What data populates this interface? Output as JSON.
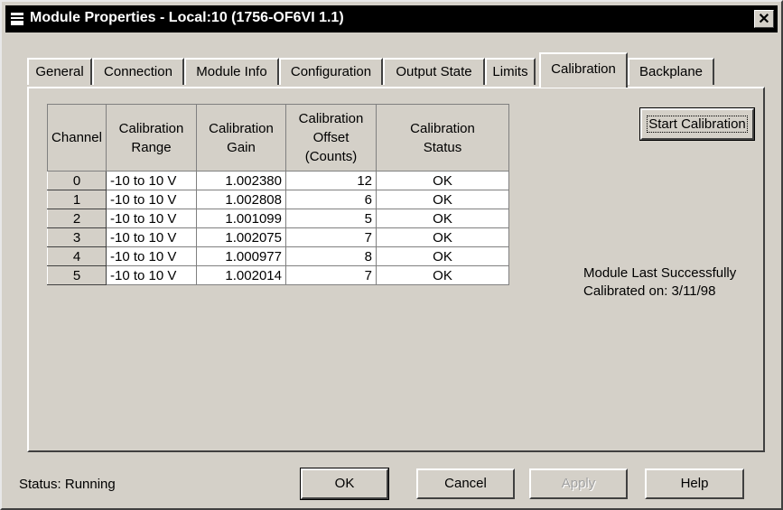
{
  "window": {
    "title": "Module Properties - Local:10 (1756-OF6VI 1.1)",
    "close_label": "✕"
  },
  "tabs": [
    {
      "label": "General"
    },
    {
      "label": "Connection"
    },
    {
      "label": "Module Info"
    },
    {
      "label": "Configuration"
    },
    {
      "label": "Output State"
    },
    {
      "label": "Limits"
    },
    {
      "label": "Calibration",
      "active": true
    },
    {
      "label": "Backplane"
    }
  ],
  "table": {
    "headers": {
      "channel": "Channel",
      "range": [
        "Calibration",
        "Range"
      ],
      "gain": [
        "Calibration",
        "Gain"
      ],
      "offset": [
        "Calibration",
        "Offset",
        "(Counts)"
      ],
      "status": [
        "Calibration",
        "Status"
      ]
    },
    "rows": [
      {
        "channel": "0",
        "range": "-10 to 10 V",
        "gain": "1.002380",
        "offset": "12",
        "status": "OK"
      },
      {
        "channel": "1",
        "range": "-10 to 10 V",
        "gain": "1.002808",
        "offset": "6",
        "status": "OK"
      },
      {
        "channel": "2",
        "range": "-10 to 10 V",
        "gain": "1.001099",
        "offset": "5",
        "status": "OK"
      },
      {
        "channel": "3",
        "range": "-10 to 10 V",
        "gain": "1.002075",
        "offset": "7",
        "status": "OK"
      },
      {
        "channel": "4",
        "range": "-10 to 10 V",
        "gain": "1.000977",
        "offset": "8",
        "status": "OK"
      },
      {
        "channel": "5",
        "range": "-10 to 10 V",
        "gain": "1.002014",
        "offset": "7",
        "status": "OK"
      }
    ]
  },
  "start_calibration_label": "Start Calibration",
  "last_calibrated": {
    "line1": "Module Last Successfully",
    "line2": "Calibrated on:  3/11/98"
  },
  "status_text": "Status:  Running",
  "buttons": {
    "ok": "OK",
    "cancel": "Cancel",
    "apply": "Apply",
    "help": "Help"
  }
}
